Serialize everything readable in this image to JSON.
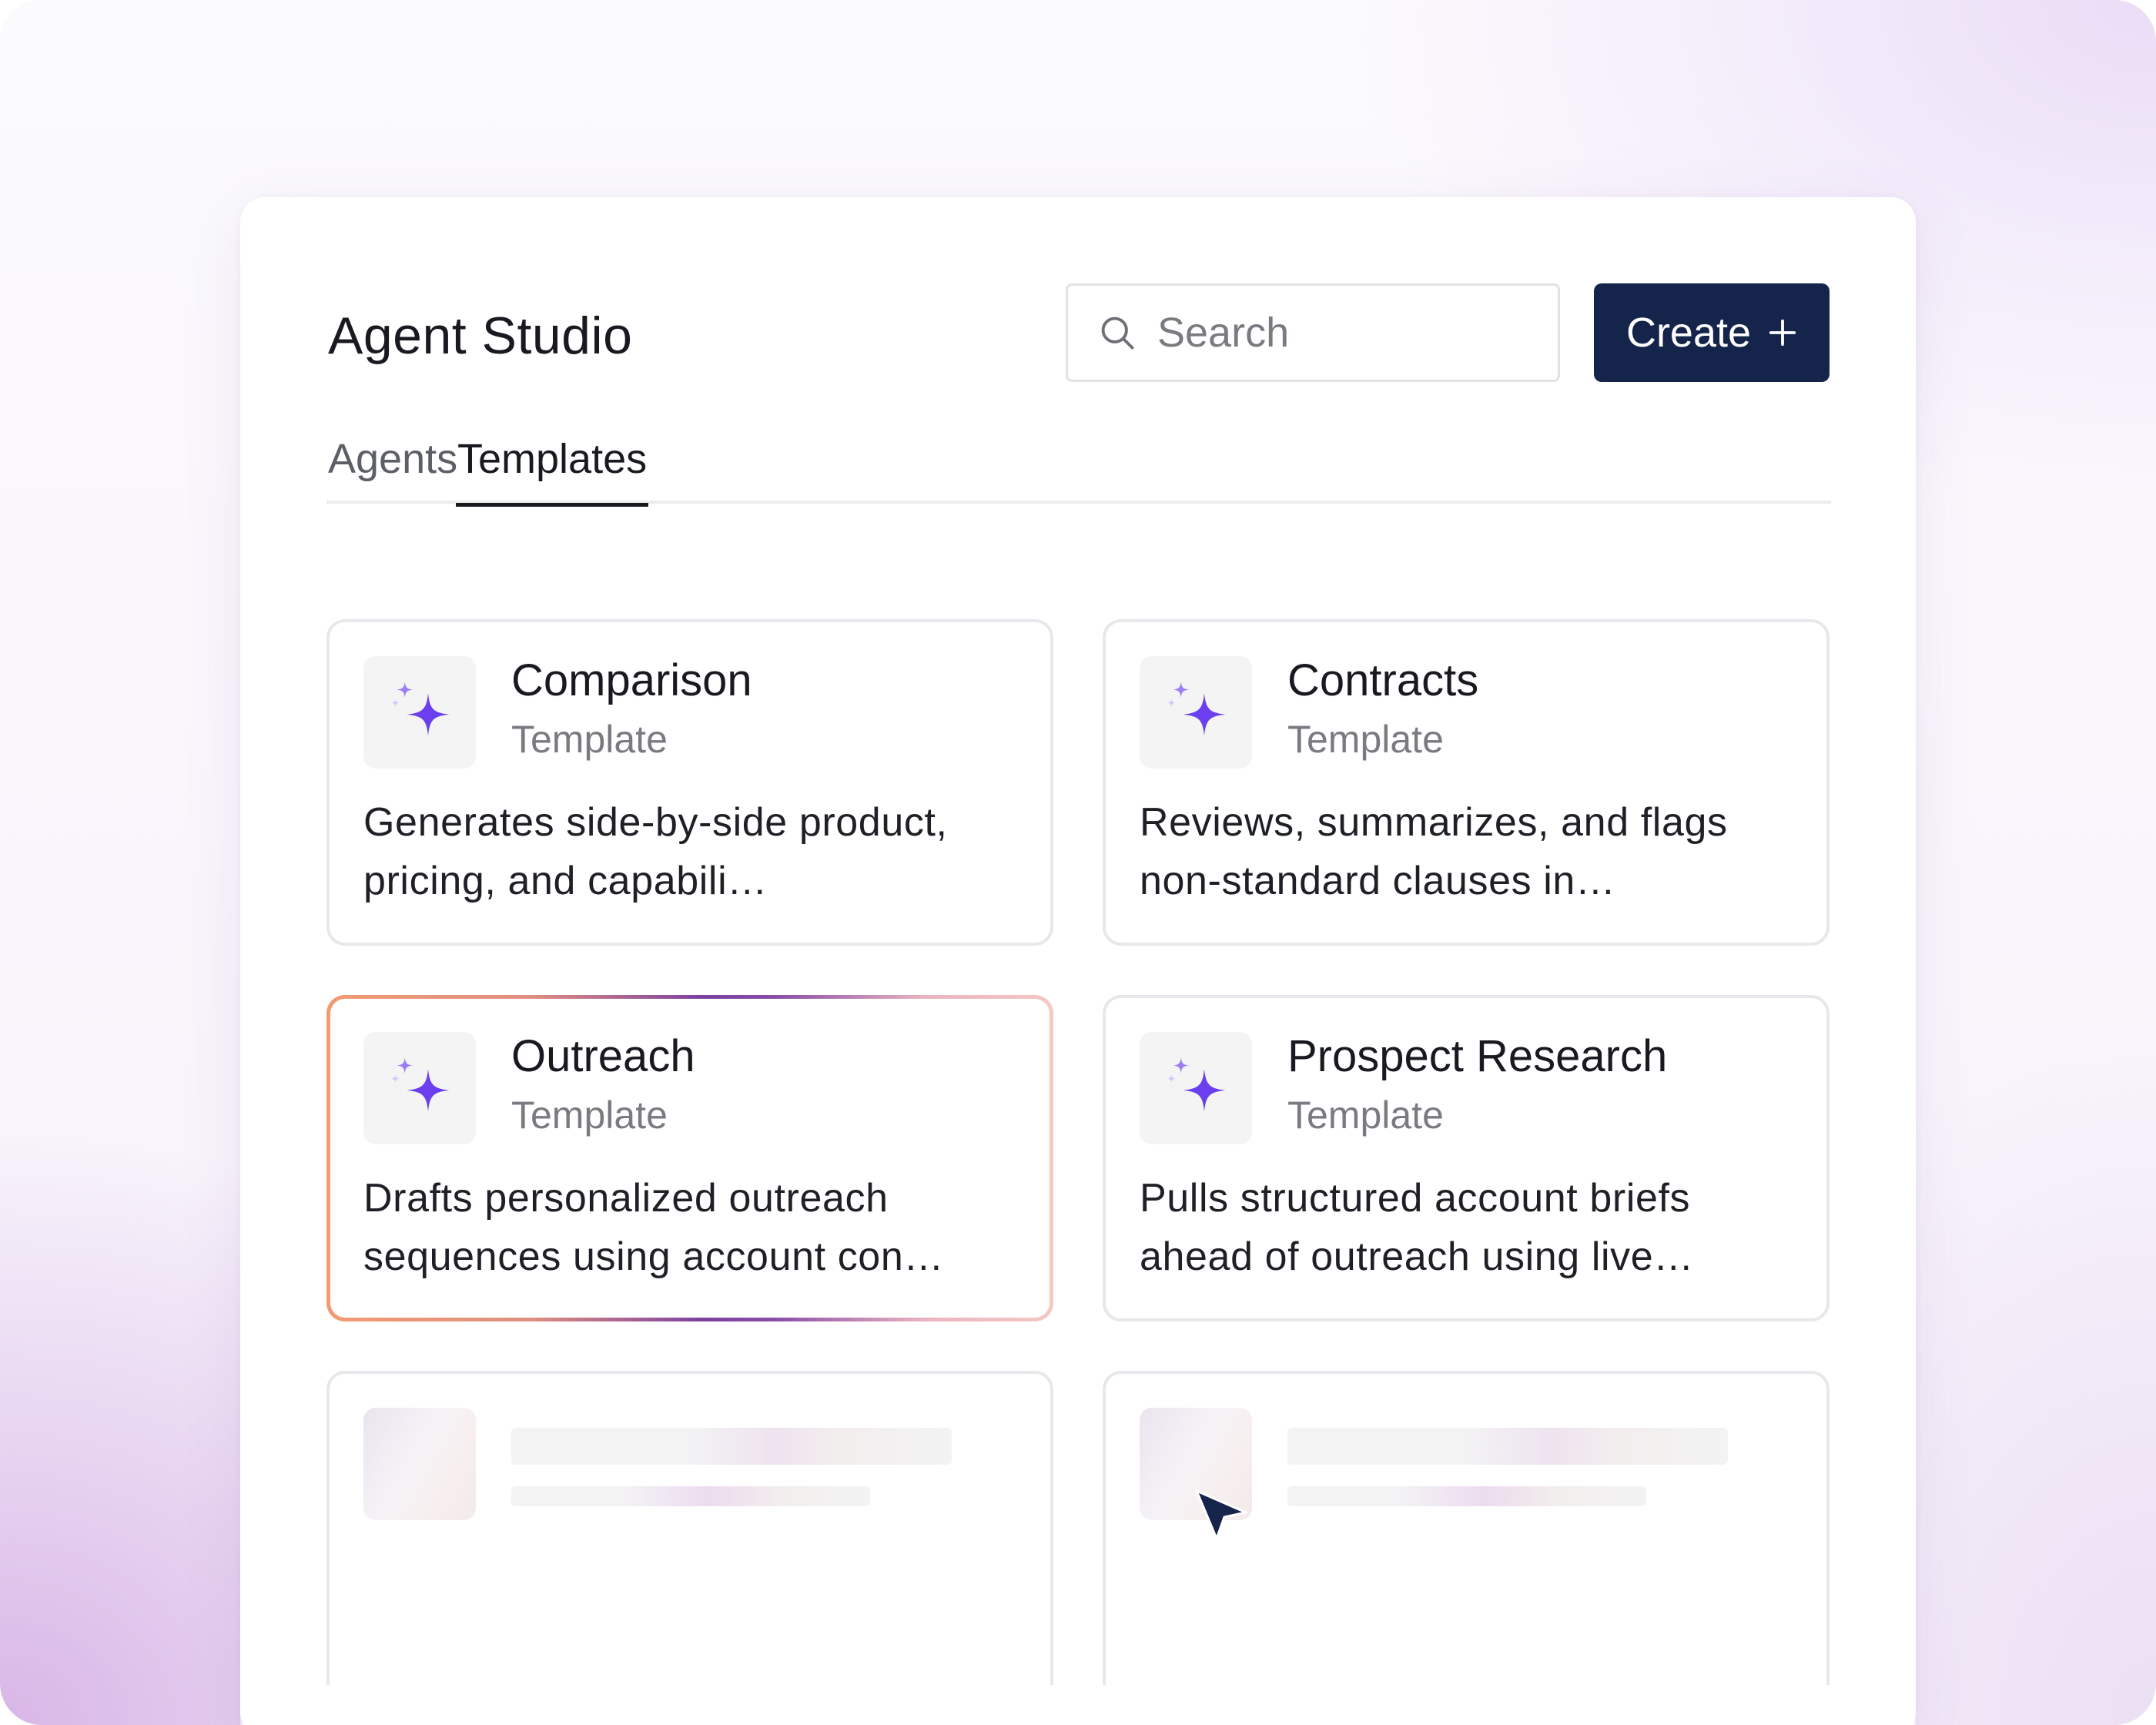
{
  "header": {
    "title": "Agent Studio",
    "search": {
      "placeholder": "Search",
      "value": ""
    },
    "create_label": "Create",
    "create_icon": "plus-icon"
  },
  "tabs": [
    {
      "label": "Agents",
      "active": false
    },
    {
      "label": "Templates",
      "active": true
    }
  ],
  "templates": [
    {
      "title": "Comparison",
      "subtitle": "Template",
      "description": "Generates side-by-side product, pricing, and capabili…",
      "icon": "sparkles-icon"
    },
    {
      "title": "Contracts",
      "subtitle": "Template",
      "description": "Reviews, summarizes, and flags non-standard clauses in…",
      "icon": "sparkles-icon"
    },
    {
      "title": "Outreach",
      "subtitle": "Template",
      "description": "Drafts personalized outreach sequences using account con…",
      "icon": "sparkles-icon",
      "hovered": true
    },
    {
      "title": "Prospect Research",
      "subtitle": "Template",
      "description": "Pulls structured account briefs ahead of outreach using live…",
      "icon": "sparkles-icon"
    }
  ],
  "loading_placeholders": 2,
  "colors": {
    "create_button": "#15244a",
    "sparkle_primary": "#6b3ff0",
    "sparkle_secondary": "#b39cf7",
    "highlight_border_start": "#f29a72",
    "highlight_border_mid": "#7b3fa0",
    "text_primary": "#181a20",
    "text_secondary": "#7a7b80"
  }
}
